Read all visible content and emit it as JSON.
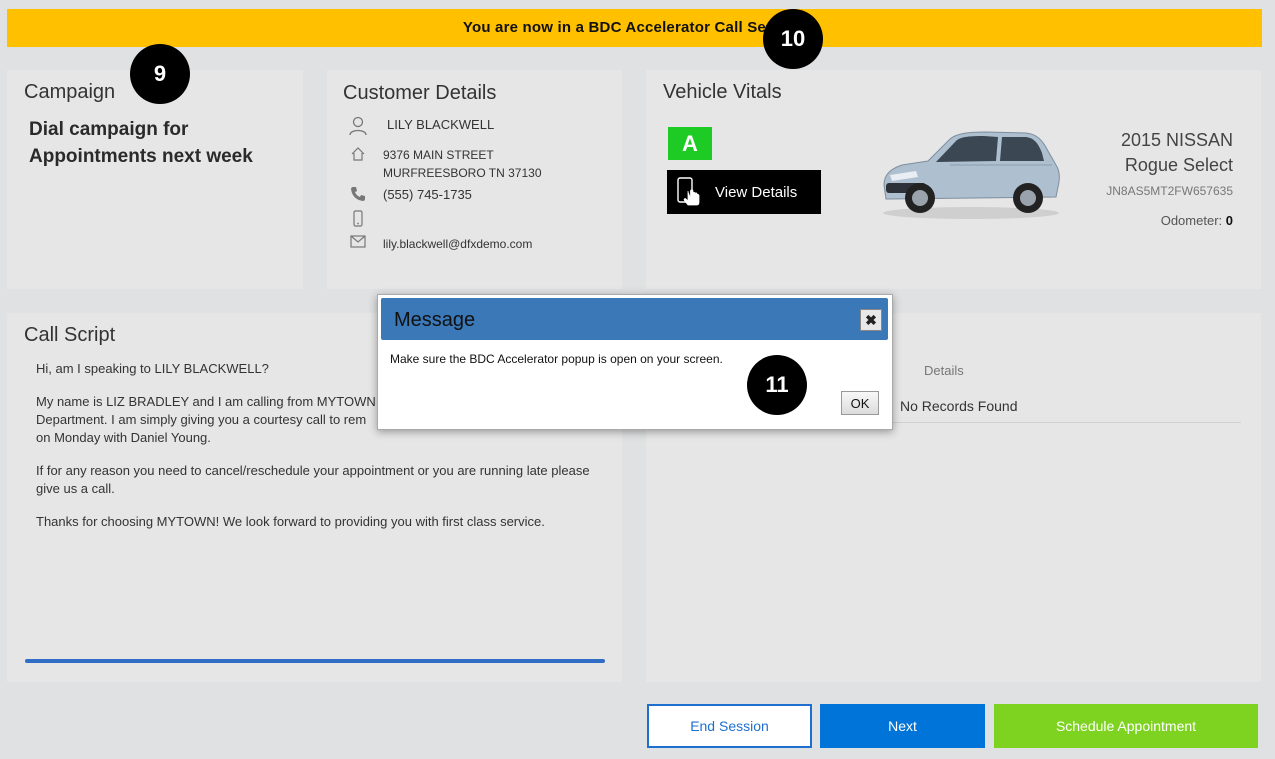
{
  "banner": {
    "text": "You are now in a BDC Accelerator Call Session"
  },
  "markers": {
    "m9": "9",
    "m10": "10",
    "m11": "11"
  },
  "campaign": {
    "title": "Campaign",
    "name": "Dial campaign for Appointments next week"
  },
  "customer": {
    "title": "Customer Details",
    "name": "LILY BLACKWELL",
    "address_line1": "9376 MAIN STREET",
    "address_line2": "MURFREESBORO TN 37130",
    "phone": "(555) 745-1735",
    "mobile": "",
    "email": "lily.blackwell@dfxdemo.com",
    "icons": [
      "user-icon",
      "home-icon",
      "phone-icon",
      "mobile-icon",
      "envelope-icon"
    ]
  },
  "vehicle": {
    "title": "Vehicle Vitals",
    "grade": "A",
    "view_details_label": "View Details",
    "year_make": "2015 NISSAN",
    "model": "Rogue Select",
    "vin": "JN8AS5MT2FW657635",
    "odometer_label": "Odometer:",
    "odometer_value": "0"
  },
  "script": {
    "title": "Call Script",
    "line1": "Hi, am I speaking to LILY BLACKWELL?",
    "line2": "My name is LIZ BRADLEY and I am calling from MYTOWN",
    "line3": "Department.  I am simply giving you a courtesy call to rem",
    "line4": "on Monday with Daniel Young.",
    "line5": "If for any reason you need to cancel/reschedule your appointment or you are running late please give us a call.",
    "line6": "Thanks for choosing MYTOWN! We look forward to providing you with first class service."
  },
  "history": {
    "details_header": "Details",
    "empty_text": "No Records Found"
  },
  "actions": {
    "end_session": "End Session",
    "next": "Next",
    "schedule": "Schedule Appointment"
  },
  "modal": {
    "title": "Message",
    "message": "Make sure the BDC Accelerator popup is open on your screen.",
    "ok": "OK",
    "close_glyph": "✖"
  },
  "colors": {
    "banner": "#ffc000",
    "grade": "#1ecb24",
    "primary": "#0074d9",
    "schedule": "#7ed321",
    "modal_header": "#3a78b8"
  }
}
